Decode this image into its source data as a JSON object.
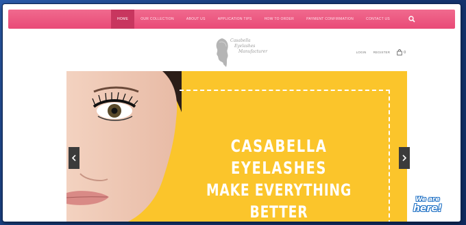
{
  "nav": {
    "items": [
      {
        "label": "HOME",
        "active": true
      },
      {
        "label": "OUR COLLECTION"
      },
      {
        "label": "ABOUT US"
      },
      {
        "label": "APPLICATION TIPS"
      },
      {
        "label": "HOW TO ORDER"
      },
      {
        "label": "PAYMENT CONFIRMATION"
      },
      {
        "label": "CONTACT US"
      }
    ],
    "search_icon": "search-icon"
  },
  "logo": {
    "line1": "Casabella",
    "line2": "Eyelashes",
    "line3": "Manufacturer"
  },
  "account": {
    "login": "LOGIN",
    "register": "REGISTER",
    "cart_count": "0",
    "cart_icon": "shopping-bag-icon"
  },
  "hero": {
    "line1": "CASABELLA EYELASHES",
    "line2": "MAKE EVERYTHING BETTER",
    "prev_icon": "chevron-left-icon",
    "next_icon": "chevron-right-icon",
    "background": "#fbc52b"
  },
  "badge": {
    "line1": "We are",
    "line2": "here!"
  },
  "colors": {
    "nav": "#e94a77",
    "nav_active": "#c8365f",
    "hero": "#fbc52b",
    "frame": "#1d3f7a"
  }
}
